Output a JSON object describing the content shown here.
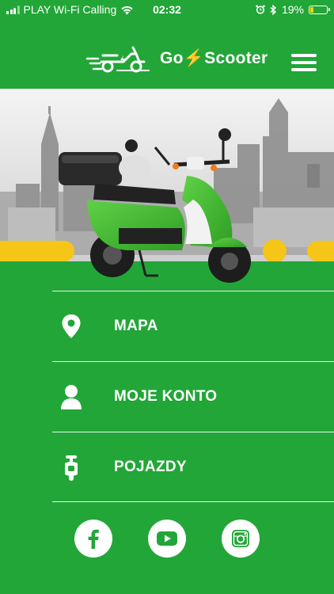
{
  "status_bar": {
    "carrier": "PLAY Wi-Fi Calling",
    "time": "02:32",
    "battery_percent": "19%",
    "battery_level": 0.19
  },
  "header": {
    "logo_text": "Go⚡Scooter",
    "menu_icon": "hamburger-menu-icon"
  },
  "colors": {
    "brand_green": "#22a638",
    "accent_yellow": "#f5c518",
    "scooter_green": "#3fbf2c",
    "battery_yellow": "#ffd400"
  },
  "menu": {
    "items": [
      {
        "label": "MAPA",
        "icon": "map-pin-icon"
      },
      {
        "label": "MOJE KONTO",
        "icon": "user-icon"
      },
      {
        "label": "POJAZDY",
        "icon": "scooter-icon"
      }
    ]
  },
  "socials": [
    {
      "name": "facebook",
      "icon": "facebook-icon"
    },
    {
      "name": "youtube",
      "icon": "youtube-icon"
    },
    {
      "name": "instagram",
      "icon": "instagram-icon"
    }
  ]
}
